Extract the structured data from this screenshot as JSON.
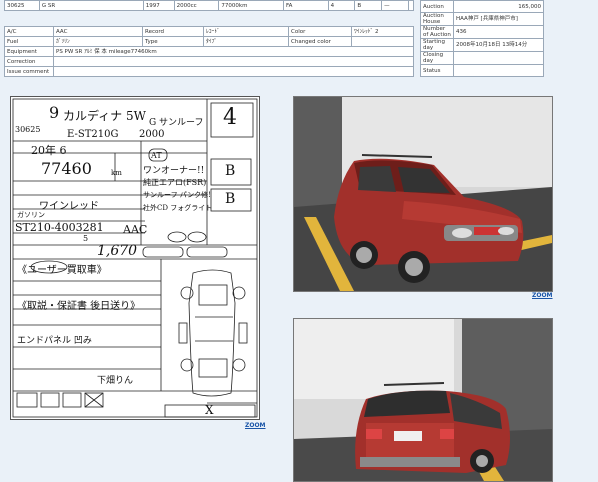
{
  "top_row": [
    "30625",
    "G SR",
    "1997",
    "2000cc",
    "77000km",
    "FA",
    "4",
    "B",
    "—",
    ""
  ],
  "info": {
    "rows": [
      {
        "l1": "A/C",
        "v1": "AAC",
        "l2": "Record",
        "v2": "ﾚｺｰﾄﾞ",
        "l3": "Color",
        "v3": "ﾜｲﾝﾚｯﾄﾞ 2"
      },
      {
        "l1": "Fuel",
        "v1": "ｶﾞｿﾘﾝ",
        "l2": "Type",
        "v2": "ﾀｲﾌﾟ",
        "l3": "Changed color",
        "v3": ""
      }
    ],
    "equipment_label": "Equipment",
    "equipment_value": "PS PW SR ｱﾙﾐ 保 本 mileage77460km",
    "correction_label": "Correction",
    "correction_value": "",
    "issue_label": "Issue comment",
    "issue_value": ""
  },
  "auction": {
    "rows": [
      {
        "label": "Auction",
        "value": "165,000"
      },
      {
        "label": "Auction House",
        "value": "HAA神戸 [兵庫県神戸市]"
      },
      {
        "label": "Number of Auction",
        "value": "436"
      },
      {
        "label": "Starting day",
        "value": "2008年10月18日 13時14分"
      },
      {
        "label": "Closing day",
        "value": ""
      },
      {
        "label": "Status",
        "value": ""
      }
    ]
  },
  "sheet": {
    "lot": "30625",
    "year_handwritten": "9",
    "model_handwritten": "カルディナ 5W",
    "grade_handwritten": "G サンルーフ",
    "code_handwritten": "E-ST210G",
    "cc_handwritten": "2000",
    "score": "4",
    "shaken": "20年 6",
    "mileage": "77460",
    "mileage_unit": "km",
    "at": "AT",
    "comment_1": "ワンオーナー!!",
    "comment_2": "純正エアロ(FSR)",
    "comment_3": "サンルーフ パンク修!",
    "comment_4": "社外CD フォグライト",
    "color_handwritten": "ワインレッド",
    "chassis": "ST210-4003281",
    "price": "1,670",
    "notes_1": "《ユーザー買取車》",
    "notes_2": "《取説・保証書 後日送り》",
    "notes_3": "エンドパネル 凹み",
    "interior_grade": "B",
    "exterior_grade": "B",
    "ac": "AAC",
    "seat": "5",
    "fuel_type": "ガソリン",
    "seller": "下畑りん",
    "zoom": "ZOOM"
  },
  "photos": {
    "zoom": "ZOOM"
  },
  "colors": {
    "car_body": "#a2302b",
    "car_dark": "#6e1e1a",
    "garage": "#c8c8c8",
    "floor": "#3f3f3f",
    "stripe": "#e2b53c",
    "link": "#1a55a8",
    "table_border": "#9aa8b8"
  }
}
